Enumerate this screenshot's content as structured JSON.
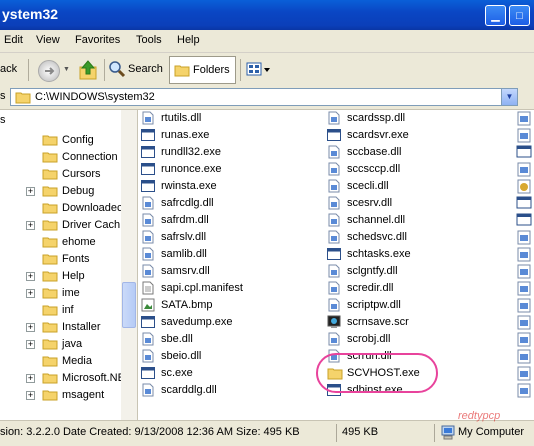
{
  "window": {
    "title": "ystem32"
  },
  "menu": [
    "Edit",
    "View",
    "Favorites",
    "Tools",
    "Help"
  ],
  "toolbar": {
    "back_label": "ack",
    "search_label": "Search",
    "folders_label": "Folders"
  },
  "address": {
    "left_label": "s",
    "path": "C:\\WINDOWS\\system32"
  },
  "tree_header": "s",
  "tree": [
    {
      "label": "Config",
      "expand": false
    },
    {
      "label": "Connection",
      "expand": false
    },
    {
      "label": "Cursors",
      "expand": false
    },
    {
      "label": "Debug",
      "expand": true
    },
    {
      "label": "Downloadec",
      "expand": false
    },
    {
      "label": "Driver Cach",
      "expand": true
    },
    {
      "label": "ehome",
      "expand": false
    },
    {
      "label": "Fonts",
      "expand": false
    },
    {
      "label": "Help",
      "expand": true
    },
    {
      "label": "ime",
      "expand": true
    },
    {
      "label": "inf",
      "expand": false
    },
    {
      "label": "Installer",
      "expand": true
    },
    {
      "label": "java",
      "expand": true
    },
    {
      "label": "Media",
      "expand": false
    },
    {
      "label": "Microsoft.NE",
      "expand": true
    },
    {
      "label": "msagent",
      "expand": true
    }
  ],
  "files_col1": [
    {
      "name": "rtutils.dll",
      "icon": "dll-icon"
    },
    {
      "name": "runas.exe",
      "icon": "exe-icon"
    },
    {
      "name": "rundll32.exe",
      "icon": "exe-icon"
    },
    {
      "name": "runonce.exe",
      "icon": "exe-icon"
    },
    {
      "name": "rwinsta.exe",
      "icon": "exe-icon"
    },
    {
      "name": "safrcdlg.dll",
      "icon": "dll-icon"
    },
    {
      "name": "safrdm.dll",
      "icon": "dll-icon"
    },
    {
      "name": "safrslv.dll",
      "icon": "dll-icon"
    },
    {
      "name": "samlib.dll",
      "icon": "dll-icon"
    },
    {
      "name": "samsrv.dll",
      "icon": "dll-icon"
    },
    {
      "name": "sapi.cpl.manifest",
      "icon": "manifest-icon"
    },
    {
      "name": "SATA.bmp",
      "icon": "bmp-icon"
    },
    {
      "name": "savedump.exe",
      "icon": "exe-icon"
    },
    {
      "name": "sbe.dll",
      "icon": "dll-icon"
    },
    {
      "name": "sbeio.dll",
      "icon": "dll-icon"
    },
    {
      "name": "sc.exe",
      "icon": "exe-icon"
    },
    {
      "name": "scarddlg.dll",
      "icon": "dll-icon"
    }
  ],
  "files_col2": [
    {
      "name": "scardssp.dll",
      "icon": "dll-icon"
    },
    {
      "name": "scardsvr.exe",
      "icon": "exe-icon"
    },
    {
      "name": "sccbase.dll",
      "icon": "dll-icon"
    },
    {
      "name": "sccsccp.dll",
      "icon": "dll-icon"
    },
    {
      "name": "scecli.dll",
      "icon": "dll-icon"
    },
    {
      "name": "scesrv.dll",
      "icon": "dll-icon"
    },
    {
      "name": "schannel.dll",
      "icon": "dll-icon"
    },
    {
      "name": "schedsvc.dll",
      "icon": "dll-icon"
    },
    {
      "name": "schtasks.exe",
      "icon": "exe-icon"
    },
    {
      "name": "sclgntfy.dll",
      "icon": "dll-icon"
    },
    {
      "name": "scredir.dll",
      "icon": "dll-icon"
    },
    {
      "name": "scriptpw.dll",
      "icon": "dll-icon"
    },
    {
      "name": "scrnsave.scr",
      "icon": "scr-icon"
    },
    {
      "name": "scrobj.dll",
      "icon": "dll-icon"
    },
    {
      "name": "scrrun.dll",
      "icon": "dll-icon"
    },
    {
      "name": "SCVHOST.exe",
      "icon": "folder-icon"
    },
    {
      "name": "sdbinst.exe",
      "icon": "exe-icon"
    }
  ],
  "status": {
    "info": "sion: 3.2.2.0 Date Created: 9/13/2008 12:36 AM Size: 495 KB",
    "size": "495 KB",
    "location": "My Computer"
  },
  "watermark": "redtypcp",
  "colors": {
    "title_blue": "#0a46c4",
    "highlight_pink": "#e8439c"
  }
}
